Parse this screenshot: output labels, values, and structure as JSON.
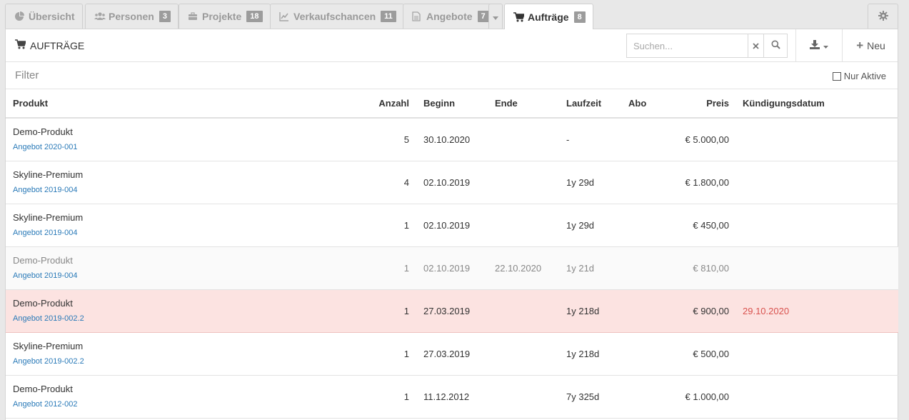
{
  "tabs": [
    {
      "label": "Übersicht",
      "badge": "",
      "icon": "pie-chart-icon"
    },
    {
      "label": "Personen",
      "badge": "3",
      "icon": "users-icon"
    },
    {
      "label": "Projekte",
      "badge": "18",
      "icon": "briefcase-icon"
    },
    {
      "label": "Verkaufschancen",
      "badge": "11",
      "icon": "line-chart-icon"
    },
    {
      "label": "Angebote",
      "badge": "7",
      "icon": "file-icon"
    },
    {
      "label": "Aufträge",
      "badge": "8",
      "icon": "cart-icon"
    }
  ],
  "header": {
    "title": "AUFTRÄGE",
    "search_placeholder": "Suchen...",
    "new_label": "Neu"
  },
  "filter": {
    "label": "Filter",
    "only_active_label": "Nur Aktive"
  },
  "table": {
    "columns": [
      "Produkt",
      "Anzahl",
      "Beginn",
      "Ende",
      "Laufzeit",
      "Abo",
      "Preis",
      "Kündigungsdatum"
    ],
    "rows": [
      {
        "product": "Demo-Produkt",
        "offer": "Angebot 2020-001",
        "qty": "5",
        "start": "30.10.2020",
        "end": "",
        "duration": "-",
        "abo": "",
        "price": "€ 5.000,00",
        "cancel": "",
        "state": "normal"
      },
      {
        "product": "Skyline-Premium",
        "offer": "Angebot 2019-004",
        "qty": "4",
        "start": "02.10.2019",
        "end": "",
        "duration": "1y 29d",
        "abo": "",
        "price": "€ 1.800,00",
        "cancel": "",
        "state": "normal"
      },
      {
        "product": "Skyline-Premium",
        "offer": "Angebot 2019-004",
        "qty": "1",
        "start": "02.10.2019",
        "end": "",
        "duration": "1y 29d",
        "abo": "",
        "price": "€ 450,00",
        "cancel": "",
        "state": "normal"
      },
      {
        "product": "Demo-Produkt",
        "offer": "Angebot 2019-004",
        "qty": "1",
        "start": "02.10.2019",
        "end": "22.10.2020",
        "duration": "1y 21d",
        "abo": "",
        "price": "€ 810,00",
        "cancel": "",
        "state": "inactive"
      },
      {
        "product": "Demo-Produkt",
        "offer": "Angebot 2019-002.2",
        "qty": "1",
        "start": "27.03.2019",
        "end": "",
        "duration": "1y 218d",
        "abo": "",
        "price": "€ 900,00",
        "cancel": "29.10.2020",
        "state": "warn"
      },
      {
        "product": "Skyline-Premium",
        "offer": "Angebot 2019-002.2",
        "qty": "1",
        "start": "27.03.2019",
        "end": "",
        "duration": "1y 218d",
        "abo": "",
        "price": "€ 500,00",
        "cancel": "",
        "state": "normal"
      },
      {
        "product": "Demo-Produkt",
        "offer": "Angebot 2012-002",
        "qty": "1",
        "start": "11.12.2012",
        "end": "",
        "duration": "7y 325d",
        "abo": "",
        "price": "€ 1.000,00",
        "cancel": "",
        "state": "normal"
      }
    ]
  },
  "colors": {
    "link": "#2a7ab8",
    "warn_row": "#fce3e1",
    "warn_text": "#d9534f",
    "badge": "#9c9c9c"
  }
}
